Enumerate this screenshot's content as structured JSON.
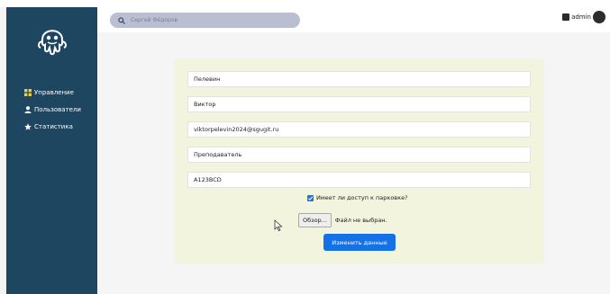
{
  "colors": {
    "sidebar": "#1e4660",
    "search_bg": "#b9bfd0",
    "card_bg": "#f3f4dd",
    "primary": "#1471e6"
  },
  "sidebar": {
    "logo_icon": "octopus-logo-icon",
    "items": [
      {
        "label": "Управление",
        "icon": "grid-icon"
      },
      {
        "label": "Пользователи",
        "icon": "user-icon"
      },
      {
        "label": "Статистика",
        "icon": "star-icon"
      }
    ]
  },
  "topbar": {
    "search": {
      "placeholder": "Сергей Фёдоров",
      "icon": "search-icon"
    },
    "user": {
      "name": "admin",
      "icon": "user-card-icon"
    }
  },
  "form": {
    "fields": [
      {
        "value": "Пелевин"
      },
      {
        "value": "Виктор"
      },
      {
        "value": "viktorpelevin2024@sgugit.ru"
      },
      {
        "value": "Преподаватель"
      },
      {
        "value": "A123BCD"
      }
    ],
    "parking_label": "Имеет ли доступ к парковке?",
    "parking_checked": true,
    "file_button": "Обзор...",
    "file_status": "Файл не выбран.",
    "submit_label": "Изменить данные"
  }
}
